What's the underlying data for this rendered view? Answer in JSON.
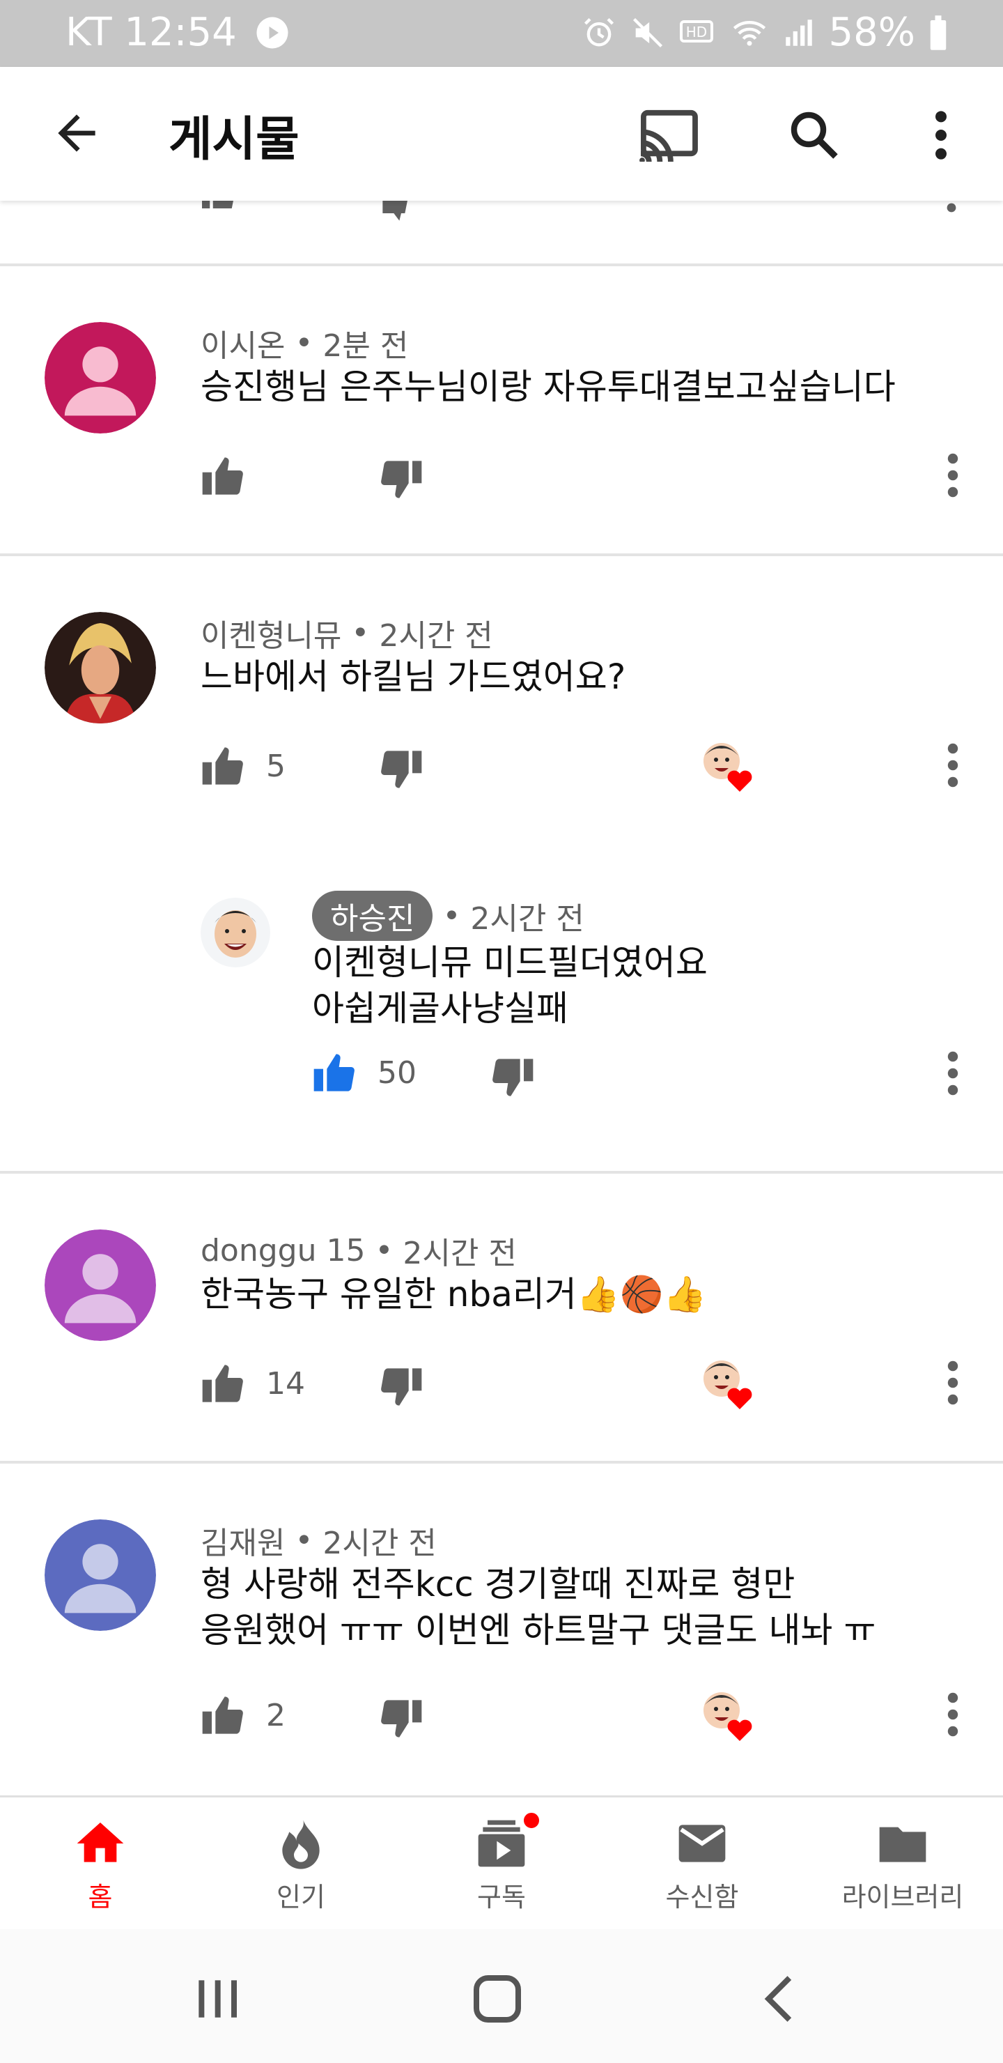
{
  "status_bar": {
    "carrier_time": "KT 12:54",
    "battery": "58%"
  },
  "app_bar": {
    "title": "게시물",
    "icons": [
      "back-arrow-icon",
      "cast-icon",
      "search-icon",
      "more-vert-icon"
    ]
  },
  "comments": [
    {
      "author": "이시온",
      "time": "2분 전",
      "text": "승진행님 은주누님이랑 자유투대결보고싶습니다",
      "likes": "",
      "avatar_color": "#c2185b"
    },
    {
      "author": "이켄형니뮤",
      "time": "2시간 전",
      "text": "느바에서 하킬님 가드였어요?",
      "likes": "5",
      "avatar_color": "#3a1f1a"
    },
    {
      "author": "donggu 15",
      "time": "2시간 전",
      "text": "한국농구 유일한 nba리거👍🏀👍",
      "likes": "14",
      "avatar_color": "#ab47bc"
    },
    {
      "author": "김재원",
      "time": "2시간 전",
      "text_line1": "형 사랑해 전주kcc 경기할때 진짜로 형만",
      "text_line2": "응원했어 ㅠㅠ 이번엔 하트말구 댓글도 내놔 ㅠ",
      "likes": "2",
      "avatar_color": "#5c6bc0"
    }
  ],
  "reply": {
    "author": "하승진",
    "time": "2시간 전",
    "text_line1": "이켄형니뮤 미드필더였어요",
    "text_line2": "아쉽게골사냥실패",
    "likes": "50",
    "like_color": "#1a73e8"
  },
  "separator": "•",
  "bottom_nav": [
    {
      "label": "홈",
      "icon": "home-icon",
      "active": true
    },
    {
      "label": "인기",
      "icon": "trending-fire-icon",
      "active": false
    },
    {
      "label": "구독",
      "icon": "subscriptions-icon",
      "active": false
    },
    {
      "label": "수신함",
      "icon": "inbox-mail-icon",
      "active": false
    },
    {
      "label": "라이브러리",
      "icon": "library-folder-icon",
      "active": false
    }
  ],
  "colors": {
    "accent_red": "#ff0000",
    "heart_red": "#ff0000",
    "text_secondary": "#606060",
    "icon_grey": "#606060"
  }
}
